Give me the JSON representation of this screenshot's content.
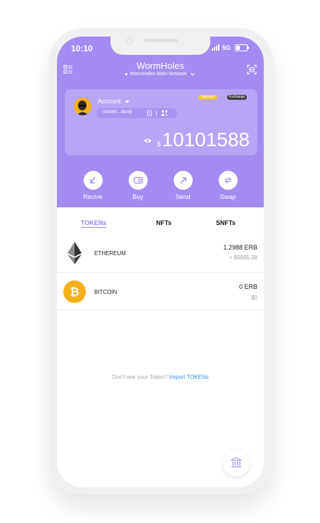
{
  "status_bar": {
    "time": "10:10",
    "network": "5G"
  },
  "header": {
    "title": "WormHoles",
    "network_label": "WormHoles Main Network"
  },
  "account": {
    "name": "Account",
    "address": "0X8090...3klo9j",
    "badges": {
      "validator": "Validator",
      "exchange": "Exchange"
    },
    "balance_currency": "$",
    "balance": "10101588"
  },
  "actions": [
    {
      "label": "Recive",
      "icon": "receive-icon"
    },
    {
      "label": "Buy",
      "icon": "wallet-icon"
    },
    {
      "label": "Send",
      "icon": "send-icon"
    },
    {
      "label": "Swap",
      "icon": "swap-icon"
    }
  ],
  "tabs": [
    {
      "label": "TOKENs",
      "active": true
    },
    {
      "label": "NFTs",
      "active": false
    },
    {
      "label": "SNFTs",
      "active": false
    }
  ],
  "tokens": [
    {
      "name": "ETHEREUM",
      "amount": "1.2988 ERB",
      "value": "≈ $5005.08",
      "icon": "ethereum-icon"
    },
    {
      "name": "BITCOIN",
      "amount": "0 ERB",
      "value": "$0",
      "icon": "bitcoin-icon"
    }
  ],
  "footer": {
    "prompt": "Don't see your Token?",
    "link": "Import TOKENs"
  },
  "colors": {
    "primary": "#a38bf2",
    "card": "#b7a5f6",
    "link": "#3b8ce8",
    "bitcoin": "#f5b11a"
  }
}
